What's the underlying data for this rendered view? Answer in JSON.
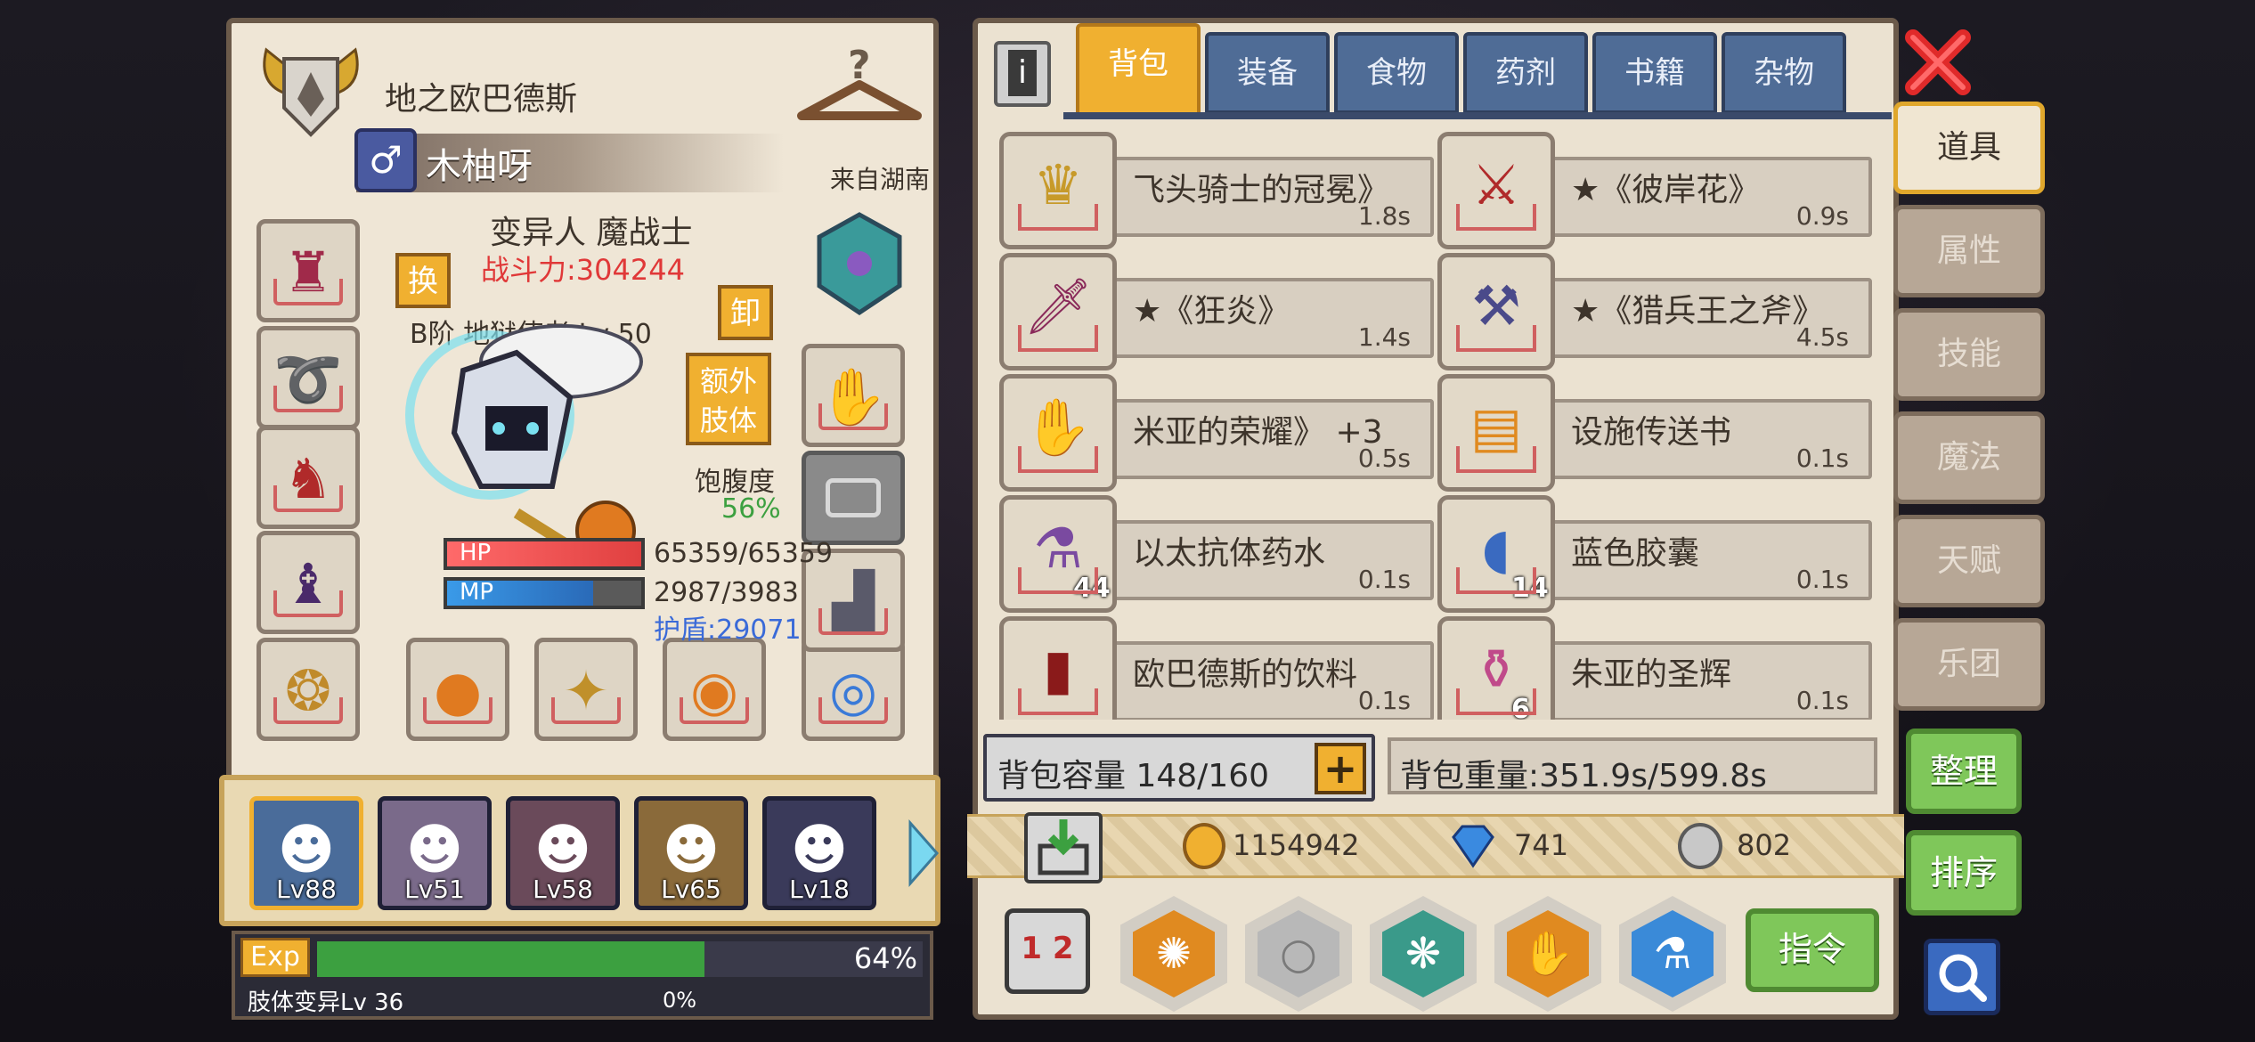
{
  "character": {
    "title": "地之欧巴德斯",
    "name": "木柚呀",
    "gender_icon": "male-icon",
    "origin": "来自湖南",
    "race_class": "变异人 魔战士",
    "combat_power": "战斗力:304244",
    "swap_label": "换",
    "unequip_label": "卸",
    "extra_limb_label": "额外肢体",
    "weapon_info": "B阶 地狱使者 Lv 50",
    "satiety_label": "饱腹度",
    "satiety_value": "56%",
    "satiety_level": 0.56,
    "hp_label": "HP",
    "hp_value": "65359/65359",
    "hp_fraction": 1.0,
    "mp_label": "MP",
    "mp_value": "2987/3983",
    "mp_fraction": 0.75,
    "shield": "护盾:29071"
  },
  "party": [
    {
      "level": "Lv88",
      "icon": "helmet-hero-icon",
      "color": "#4a6c9a"
    },
    {
      "level": "Lv51",
      "icon": "silver-hair-hero-icon",
      "color": "#7a6a8a"
    },
    {
      "level": "Lv58",
      "icon": "pink-hair-hero-icon",
      "color": "#6a4a5a"
    },
    {
      "level": "Lv65",
      "icon": "blonde-hero-icon",
      "color": "#8a6a3a"
    },
    {
      "level": "Lv18",
      "icon": "pirate-hero-icon",
      "color": "#3a3a5a"
    }
  ],
  "exp": {
    "label": "Exp",
    "percent_text": "64%",
    "fraction": 0.64,
    "limb_label": "肢体变异Lv 36",
    "limb_percent": "0%"
  },
  "tabs": [
    "背包",
    "装备",
    "食物",
    "药剂",
    "书籍",
    "杂物"
  ],
  "side_tabs": [
    "道具",
    "属性",
    "技能",
    "魔法",
    "天赋",
    "乐团"
  ],
  "items": [
    {
      "name": "飞头骑士的冠冕》",
      "time": "1.8s",
      "icon": "crown-icon",
      "glyph": "♛",
      "color": "#c79a2a",
      "count": ""
    },
    {
      "name": "★《彼岸花》",
      "time": "0.9s",
      "icon": "red-blade-icon",
      "glyph": "⚔",
      "color": "#b02a2a",
      "count": ""
    },
    {
      "name": "★《狂炎》",
      "time": "1.4s",
      "icon": "sword-icon",
      "glyph": "🗡",
      "color": "#8a2a5a",
      "count": ""
    },
    {
      "name": "★《猎兵王之斧》",
      "time": "4.5s",
      "icon": "axe-icon",
      "glyph": "⚒",
      "color": "#4a4a8a",
      "count": ""
    },
    {
      "name": "米亚的荣耀》 +3",
      "time": "0.5s",
      "icon": "gauntlet-icon",
      "glyph": "✋",
      "color": "#3a5a9a",
      "count": ""
    },
    {
      "name": "设施传送书",
      "time": "0.1s",
      "icon": "book-icon",
      "glyph": "▤",
      "color": "#e08a20",
      "count": ""
    },
    {
      "name": "以太抗体药水",
      "time": "0.1s",
      "icon": "potion-flask-icon",
      "glyph": "⚗",
      "color": "#7a4aa0",
      "count": "44"
    },
    {
      "name": "蓝色胶囊",
      "time": "0.1s",
      "icon": "capsule-icon",
      "glyph": "◖",
      "color": "#3a6ac0",
      "count": "14"
    },
    {
      "name": "欧巴德斯的饮料",
      "time": "0.1s",
      "icon": "bottle-icon",
      "glyph": "▮",
      "color": "#8a1a1a",
      "count": ""
    },
    {
      "name": "朱亚的圣辉",
      "time": "0.1s",
      "icon": "heart-flask-icon",
      "glyph": "⚱",
      "color": "#c04a8a",
      "count": "6"
    }
  ],
  "bag": {
    "capacity": "背包容量 148/160",
    "weight": "背包重量:351.9s/599.8s"
  },
  "currency": {
    "gold": "1154942",
    "diamond": "741",
    "silver": "802"
  },
  "buttons": {
    "organize": "整理",
    "sort": "排序",
    "command": "指令",
    "info": "i",
    "plus": "+",
    "page_indicator": "1 2"
  },
  "colors": {
    "panel_bg": "#efe6d6",
    "tab_active": "#f0b030",
    "tab_inactive": "#4f6c96",
    "hp_red": "#e05050",
    "mp_blue": "#3a8ad8",
    "exp_green": "#3ca040",
    "combat_red": "#e03838",
    "shield_blue": "#3a6ad8"
  }
}
